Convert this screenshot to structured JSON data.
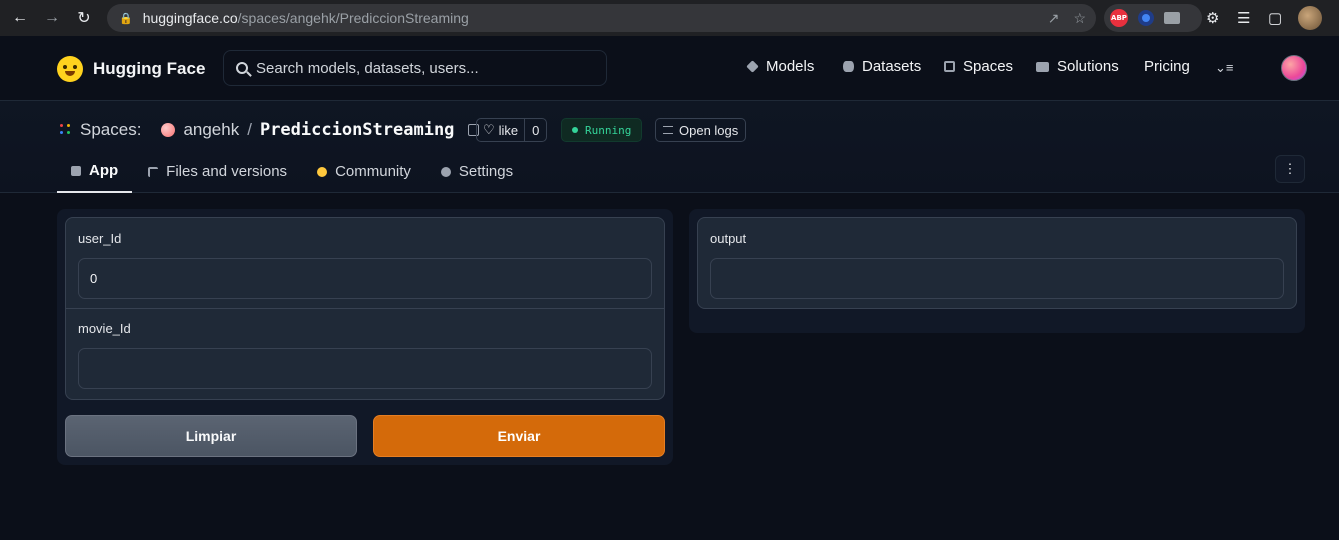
{
  "browser": {
    "url_host": "huggingface.co",
    "url_path": "/spaces/angehk/PrediccionStreaming",
    "abp_label": "ABP"
  },
  "header": {
    "brand": "Hugging Face",
    "search_placeholder": "Search models, datasets, users...",
    "nav": [
      {
        "label": "Models",
        "icon": "cube-icon"
      },
      {
        "label": "Datasets",
        "icon": "database-icon"
      },
      {
        "label": "Spaces",
        "icon": "grid-icon"
      },
      {
        "label": "Solutions",
        "icon": "briefcase-icon"
      },
      {
        "label": "Pricing",
        "icon": ""
      }
    ]
  },
  "space": {
    "section_label": "Spaces:",
    "owner": "angehk",
    "separator": "/",
    "name": "PrediccionStreaming",
    "like_label": "like",
    "like_count": "0",
    "status": "Running",
    "status_color": "#34d399",
    "logs_label": "Open logs",
    "tabs": [
      {
        "label": "App",
        "active": true
      },
      {
        "label": "Files and versions",
        "active": false
      },
      {
        "label": "Community",
        "active": false
      },
      {
        "label": "Settings",
        "active": false
      }
    ]
  },
  "app": {
    "inputs": [
      {
        "label": "user_Id",
        "value": "0"
      },
      {
        "label": "movie_Id",
        "value": ""
      }
    ],
    "clear_label": "Limpiar",
    "submit_label": "Enviar",
    "submit_color": "#d46a0a",
    "output_label": "output",
    "output_value": ""
  }
}
